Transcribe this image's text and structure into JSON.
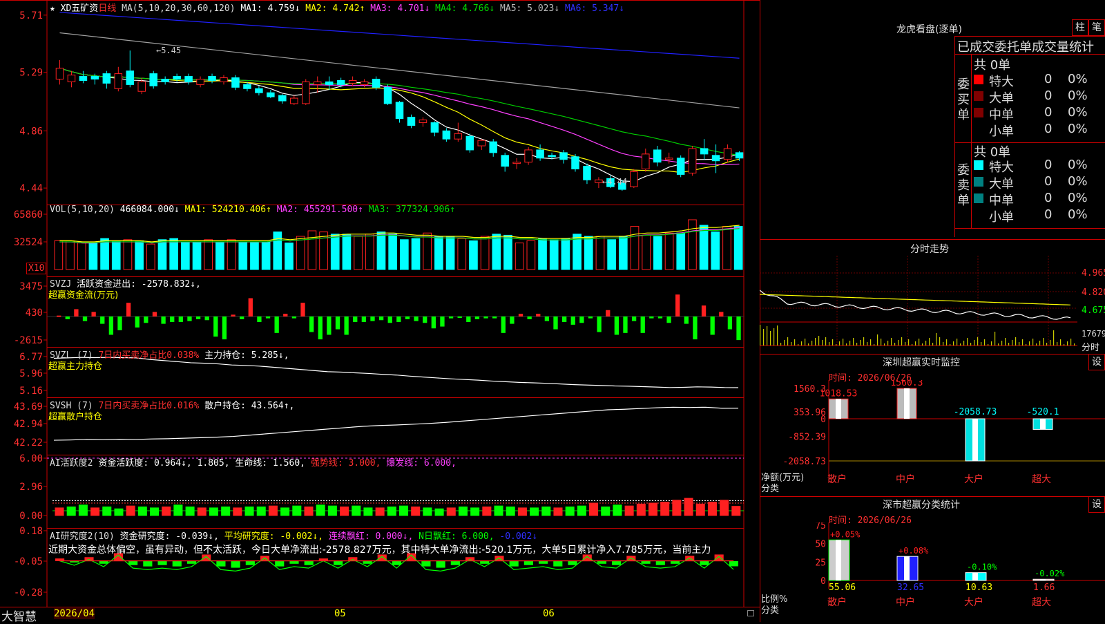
{
  "app": {
    "brand": "大智慧",
    "timeframe": "日线",
    "stock": "XD五矿资"
  },
  "colors": {
    "up": "#ff2020",
    "down": "#00ffff",
    "frame": "#cc0000",
    "ma1": "#ffffff",
    "ma2": "#ffff00",
    "ma3": "#ff40ff",
    "ma4": "#00cc00",
    "ma5": "#a0a0a0",
    "ma6": "#2020ff",
    "bar_green": "#00ff00"
  },
  "main": {
    "header": {
      "prefix": "★",
      "stock": "XD五矿资",
      "period": "日线",
      "ma_label": "MA(5,10,20,30,60,120)",
      "ma1": "MA1: 4.759↓",
      "ma2": "MA2: 4.742↑",
      "ma3": "MA3: 4.701↓",
      "ma4": "MA4: 4.766↓",
      "ma5": "MA5: 5.023↓",
      "ma6": "MA6: 5.347↓"
    },
    "yticks": [
      "5.71",
      "5.29",
      "4.86",
      "4.44"
    ],
    "high_note": "←5.45",
    "low_note": "←4.44"
  },
  "vol": {
    "header": {
      "label": "VOL(5,10,20)",
      "value": "466084.000↓",
      "ma1": "MA1: 524210.406↑",
      "ma2": "MA2: 455291.500↑",
      "ma3": "MA3: 377324.906↑"
    },
    "yticks": [
      "65860",
      "32524"
    ],
    "unit": "X10"
  },
  "svzj": {
    "header": {
      "label": "SVZJ",
      "value": "活跃资金进出: -2578.832↓,"
    },
    "sub": "超赢资金流(万元)",
    "yticks": [
      "3475",
      "430",
      "-2615"
    ]
  },
  "svzl": {
    "header": {
      "label": "SVZL (7)",
      "ratio": "7日内买卖净占比0.038%",
      "value": "主力持仓: 5.285↓,"
    },
    "sub": "超赢主力持仓",
    "yticks": [
      "6.77",
      "5.96",
      "5.16"
    ]
  },
  "svsh": {
    "header": {
      "label": "SVSH (7)",
      "ratio": "7日内买卖净占比0.016%",
      "value": "散户持仓: 43.564↑,"
    },
    "sub": "超赢散户持仓",
    "yticks": [
      "43.69",
      "42.94",
      "42.22"
    ]
  },
  "ai1": {
    "header": {
      "label": "AI活跃度2",
      "v1": "资金活跃度: 0.964↓, 1.805,",
      "v2": "生命线: 1.560,",
      "v3": "强势线: 3.000,",
      "v4": "爆发线: 6.000,"
    },
    "yticks": [
      "6.00",
      "2.96",
      "0.00"
    ]
  },
  "ai2": {
    "header": {
      "label": "AI研究度2(10)",
      "v1": "资金研究度: -0.039↓,",
      "v2": "平均研究度: -0.002↓,",
      "v3": "连续飘红: 0.000↓,",
      "v4": "N日飘红: 6.000,",
      "v5": "-0.002↓"
    },
    "comment": "近期大资金总体偏空，虽有异动，但不太活跃，今日大单净流出:-2578.827万元，其中特大单净流出:-520.1万元，大单5日累计净入7.785万元，当前主力",
    "yticks": [
      "0.18",
      "-0.05",
      "-0.28"
    ]
  },
  "xaxis": {
    "labels": [
      "2026/04",
      "05",
      "06"
    ]
  },
  "side": {
    "lhb": {
      "title": "龙虎看盘(逐单)",
      "btn1": "柱",
      "btn2": "笔",
      "subtitle": "已成交委托单成交量统计",
      "buy": {
        "label": "委买单",
        "total": "共 0单",
        "rows": [
          {
            "name": "特大",
            "count": "0",
            "pct": "0%"
          },
          {
            "name": "大单",
            "count": "0",
            "pct": "0%"
          },
          {
            "name": "中单",
            "count": "0",
            "pct": "0%"
          },
          {
            "name": "小单",
            "count": "0",
            "pct": "0%"
          }
        ]
      },
      "sell": {
        "label": "委卖单",
        "total": "共 0单",
        "rows": [
          {
            "name": "特大",
            "count": "0",
            "pct": "0%"
          },
          {
            "name": "大单",
            "count": "0",
            "pct": "0%"
          },
          {
            "name": "中单",
            "count": "0",
            "pct": "0%"
          },
          {
            "name": "小单",
            "count": "0",
            "pct": "0%"
          }
        ]
      }
    },
    "fenshi": {
      "title": "分时走势",
      "yticks": [
        "4.965",
        "4.820",
        "4.675"
      ],
      "vol_label": "17679",
      "footer": "分时"
    },
    "monitor": {
      "title": "深圳超赢实时监控",
      "btn": "设",
      "time": "时间: 2026/06/26",
      "yticks": [
        "1560.3",
        "353.96",
        "0",
        "-852.39",
        "-2058.73"
      ],
      "ylabel": "净额(万元)",
      "xlabel": "分类",
      "categories": [
        "散户",
        "中户",
        "大户",
        "超大"
      ],
      "values": [
        1018.53,
        1560.3,
        -2058.73,
        -520.1
      ],
      "value_labels": [
        "1018.53",
        "1560.3",
        "-2058.73",
        "-520.1"
      ]
    },
    "classify": {
      "title": "深市超赢分类统计",
      "btn": "设",
      "time": "时间: 2026/06/26",
      "yticks": [
        "75",
        "50",
        "25",
        "0"
      ],
      "ylabel": "比例%",
      "xlabel": "分类",
      "categories": [
        "散户",
        "中户",
        "大户",
        "超大"
      ],
      "values": [
        55.06,
        32.65,
        10.63,
        1.66
      ],
      "changes": [
        "+0.05%",
        "+0.08%",
        "-0.10%",
        "-0.02%"
      ],
      "value_labels": [
        "55.06",
        "32.65",
        "10.63",
        "1.66"
      ]
    }
  },
  "chart_data": [
    {
      "type": "candlestick",
      "title": "XD五矿资 日线",
      "ylim": [
        4.4,
        5.75
      ],
      "candles": [
        [
          5.24,
          5.32,
          5.2,
          5.38
        ],
        [
          5.22,
          5.27,
          5.18,
          5.3
        ],
        [
          5.26,
          5.23,
          5.21,
          5.3
        ],
        [
          5.26,
          5.24,
          5.2,
          5.28
        ],
        [
          5.28,
          5.21,
          5.17,
          5.3
        ],
        [
          5.17,
          5.28,
          5.15,
          5.33
        ],
        [
          5.3,
          5.2,
          5.18,
          5.45
        ],
        [
          5.15,
          5.22,
          5.13,
          5.25
        ],
        [
          5.28,
          5.19,
          5.17,
          5.3
        ],
        [
          5.24,
          5.22,
          5.2,
          5.26
        ],
        [
          5.26,
          5.24,
          5.22,
          5.28
        ],
        [
          5.26,
          5.22,
          5.2,
          5.28
        ],
        [
          5.2,
          5.24,
          5.18,
          5.26
        ],
        [
          5.26,
          5.23,
          5.21,
          5.28
        ],
        [
          5.22,
          5.25,
          5.2,
          5.27
        ],
        [
          5.25,
          5.18,
          5.16,
          5.27
        ],
        [
          5.2,
          5.17,
          5.15,
          5.22
        ],
        [
          5.17,
          5.14,
          5.12,
          5.19
        ],
        [
          5.14,
          5.11,
          5.1,
          5.16
        ],
        [
          5.12,
          5.08,
          5.06,
          5.13
        ],
        [
          5.06,
          5.1,
          5.05,
          5.12
        ],
        [
          5.06,
          5.22,
          5.05,
          5.24
        ],
        [
          5.2,
          5.22,
          5.14,
          5.26
        ],
        [
          5.22,
          5.2,
          5.16,
          5.26
        ],
        [
          5.23,
          5.2,
          5.18,
          5.25
        ],
        [
          5.21,
          5.23,
          5.19,
          5.26
        ],
        [
          5.2,
          5.22,
          5.18,
          5.24
        ],
        [
          5.24,
          5.18,
          5.16,
          5.26
        ],
        [
          5.18,
          5.06,
          5.05,
          5.2
        ],
        [
          5.07,
          4.95,
          4.92,
          5.08
        ],
        [
          4.96,
          4.9,
          4.88,
          4.98
        ],
        [
          4.92,
          4.94,
          4.89,
          4.96
        ],
        [
          4.92,
          4.85,
          4.82,
          4.93
        ],
        [
          4.86,
          4.8,
          4.78,
          4.88
        ],
        [
          4.8,
          4.84,
          4.78,
          4.92
        ],
        [
          4.82,
          4.72,
          4.7,
          4.84
        ],
        [
          4.75,
          4.79,
          4.72,
          4.8
        ],
        [
          4.78,
          4.7,
          4.67,
          4.8
        ],
        [
          4.68,
          4.6,
          4.56,
          4.7
        ],
        [
          4.62,
          4.63,
          4.58,
          4.66
        ],
        [
          4.63,
          4.72,
          4.61,
          4.74
        ],
        [
          4.72,
          4.66,
          4.64,
          4.76
        ],
        [
          4.68,
          4.67,
          4.65,
          4.7
        ],
        [
          4.7,
          4.65,
          4.62,
          4.72
        ],
        [
          4.67,
          4.58,
          4.56,
          4.69
        ],
        [
          4.6,
          4.5,
          4.47,
          4.62
        ],
        [
          4.48,
          4.5,
          4.44,
          4.52
        ],
        [
          4.51,
          4.45,
          4.44,
          4.53
        ],
        [
          4.48,
          4.43,
          4.42,
          4.5
        ],
        [
          4.45,
          4.56,
          4.44,
          4.58
        ],
        [
          4.58,
          4.69,
          4.56,
          4.73
        ],
        [
          4.72,
          4.63,
          4.6,
          4.75
        ],
        [
          4.65,
          4.66,
          4.62,
          4.7
        ],
        [
          4.66,
          4.54,
          4.52,
          4.68
        ],
        [
          4.55,
          4.73,
          4.53,
          4.75
        ],
        [
          4.73,
          4.69,
          4.65,
          4.8
        ],
        [
          4.68,
          4.64,
          4.55,
          4.76
        ],
        [
          4.65,
          4.73,
          4.63,
          4.76
        ],
        [
          4.7,
          4.66,
          4.64,
          4.71
        ]
      ]
    },
    {
      "type": "bar",
      "title": "VOL(5,10,20)",
      "values": [
        26,
        26,
        24,
        25,
        28,
        26,
        27,
        26,
        23,
        27,
        28,
        25,
        25,
        27,
        25,
        27,
        25,
        25,
        25,
        34,
        24,
        30,
        35,
        34,
        32,
        32,
        30,
        32,
        34,
        32,
        27,
        28,
        33,
        30,
        30,
        28,
        26,
        30,
        32,
        31,
        24,
        26,
        28,
        27,
        28,
        32,
        30,
        30,
        27,
        30,
        39,
        31,
        30,
        33,
        33,
        45,
        40,
        34,
        39,
        39
      ],
      "series": [
        {
          "name": "MA1",
          "values": [
            26,
            26,
            25,
            25,
            26,
            26,
            26,
            26,
            25,
            26,
            26,
            26,
            26,
            26,
            26,
            26,
            26,
            26,
            26,
            28,
            27,
            28,
            29,
            30,
            31,
            32,
            32,
            32,
            33,
            33,
            32,
            31,
            31,
            30,
            30,
            30,
            29,
            29,
            30,
            30,
            29,
            29,
            28,
            28,
            28,
            29,
            29,
            30,
            30,
            30,
            32,
            33,
            33,
            34,
            35,
            37,
            38,
            38,
            39,
            40
          ]
        }
      ]
    },
    {
      "type": "bar",
      "title": "SVZJ 活跃资金进出",
      "ylim": [
        -2615,
        3475
      ],
      "values": [
        100,
        -300,
        800,
        -500,
        500,
        -800,
        -2000,
        -1500,
        1500,
        -1200,
        -700,
        500,
        -800,
        -600,
        -600,
        -500,
        -300,
        -400,
        -2200,
        -2500,
        200,
        -300,
        2000,
        -600,
        -200,
        -1800,
        300,
        -200,
        1500,
        -1700,
        -2500,
        -2000,
        -1400,
        -2000,
        -600,
        -600,
        -500,
        -400,
        -700,
        -600,
        -300,
        -500,
        -700,
        -1300,
        -1100,
        -200,
        -100,
        -600,
        -300,
        -200,
        -200,
        -1800,
        -800,
        300,
        -300,
        300,
        -500,
        -1400,
        -600,
        -900,
        -700,
        -200,
        -1700,
        700,
        -2000,
        -1800,
        -500,
        -1800,
        -200,
        -200,
        -700,
        2400,
        -800,
        -2500,
        1200,
        -2000,
        500,
        -1400,
        -2578
      ]
    },
    {
      "type": "line",
      "title": "SVZL 主力持仓",
      "ylim": [
        5.16,
        6.77
      ],
      "values": [
        6.6,
        6.62,
        6.64,
        6.63,
        6.64,
        6.63,
        6.62,
        6.55,
        6.5,
        6.45,
        6.4,
        6.38,
        6.35,
        6.3,
        6.28,
        6.25,
        6.2,
        6.15,
        6.1,
        6.05,
        6.0,
        5.98,
        5.95,
        5.92,
        5.88,
        5.85,
        5.8,
        5.76,
        5.72,
        5.68,
        5.65,
        5.62,
        5.58,
        5.55,
        5.52,
        5.5,
        5.48,
        5.45,
        5.42,
        5.4,
        5.38,
        5.36,
        5.35,
        5.33,
        5.31,
        5.29,
        5.3,
        5.32,
        5.31,
        5.29,
        5.285
      ]
    },
    {
      "type": "line",
      "title": "SVSH 散户持仓",
      "ylim": [
        42.22,
        43.69
      ],
      "values": [
        42.3,
        42.31,
        42.33,
        42.32,
        42.34,
        42.33,
        42.35,
        42.36,
        42.38,
        42.4,
        42.42,
        42.45,
        42.5,
        42.55,
        42.6,
        42.65,
        42.7,
        42.75,
        42.8,
        42.85,
        42.88,
        42.9,
        42.93,
        42.96,
        43.0,
        43.05,
        43.1,
        43.15,
        43.2,
        43.25,
        43.3,
        43.35,
        43.4,
        43.45,
        43.5,
        43.52,
        43.55,
        43.58,
        43.6,
        43.59,
        43.6,
        43.56,
        43.564
      ]
    },
    {
      "type": "bar",
      "title": "AI活跃度2",
      "ylim": [
        0,
        6
      ],
      "values": [
        0.8,
        0.9,
        1.1,
        0.8,
        0.9,
        0.7,
        1.0,
        0.9,
        0.8,
        0.9,
        1.1,
        0.9,
        0.8,
        0.8,
        0.9,
        0.8,
        0.9,
        0.9,
        1.0,
        0.8,
        1.0,
        0.9,
        1.1,
        1.0,
        0.9,
        1.0,
        0.8,
        0.8,
        0.9,
        1.0,
        0.9,
        0.8,
        0.7,
        0.8,
        0.9,
        0.8,
        0.9,
        1.0,
        0.9,
        0.8,
        0.8,
        0.9,
        0.8,
        0.9,
        1.0,
        1.3,
        0.9,
        1.1,
        1.0,
        1.2,
        1.3,
        1.4,
        1.6,
        1.8,
        1.2,
        1.4,
        1.6,
        0.964
      ]
    },
    {
      "type": "bar",
      "title": "AI研究度2(10)",
      "ylim": [
        -0.28,
        0.18
      ],
      "values": [
        0.02,
        -0.01,
        0.03,
        -0.02,
        0.06,
        -0.03,
        -0.04,
        -0.03,
        -0.04,
        -0.02,
        0.05,
        -0.04,
        -0.05,
        -0.03,
        0.04,
        -0.04,
        -0.02,
        -0.03,
        0.02,
        -0.03,
        0.03,
        -0.02,
        0.05,
        -0.03,
        0.06,
        -0.04,
        -0.05,
        -0.03,
        0.03,
        -0.02,
        0.04,
        -0.04,
        -0.03,
        -0.02,
        -0.04,
        -0.03,
        0.05,
        -0.02,
        -0.03,
        0.04,
        -0.02,
        -0.03,
        -0.02,
        0.04,
        -0.03,
        0.05,
        -0.039
      ]
    }
  ]
}
